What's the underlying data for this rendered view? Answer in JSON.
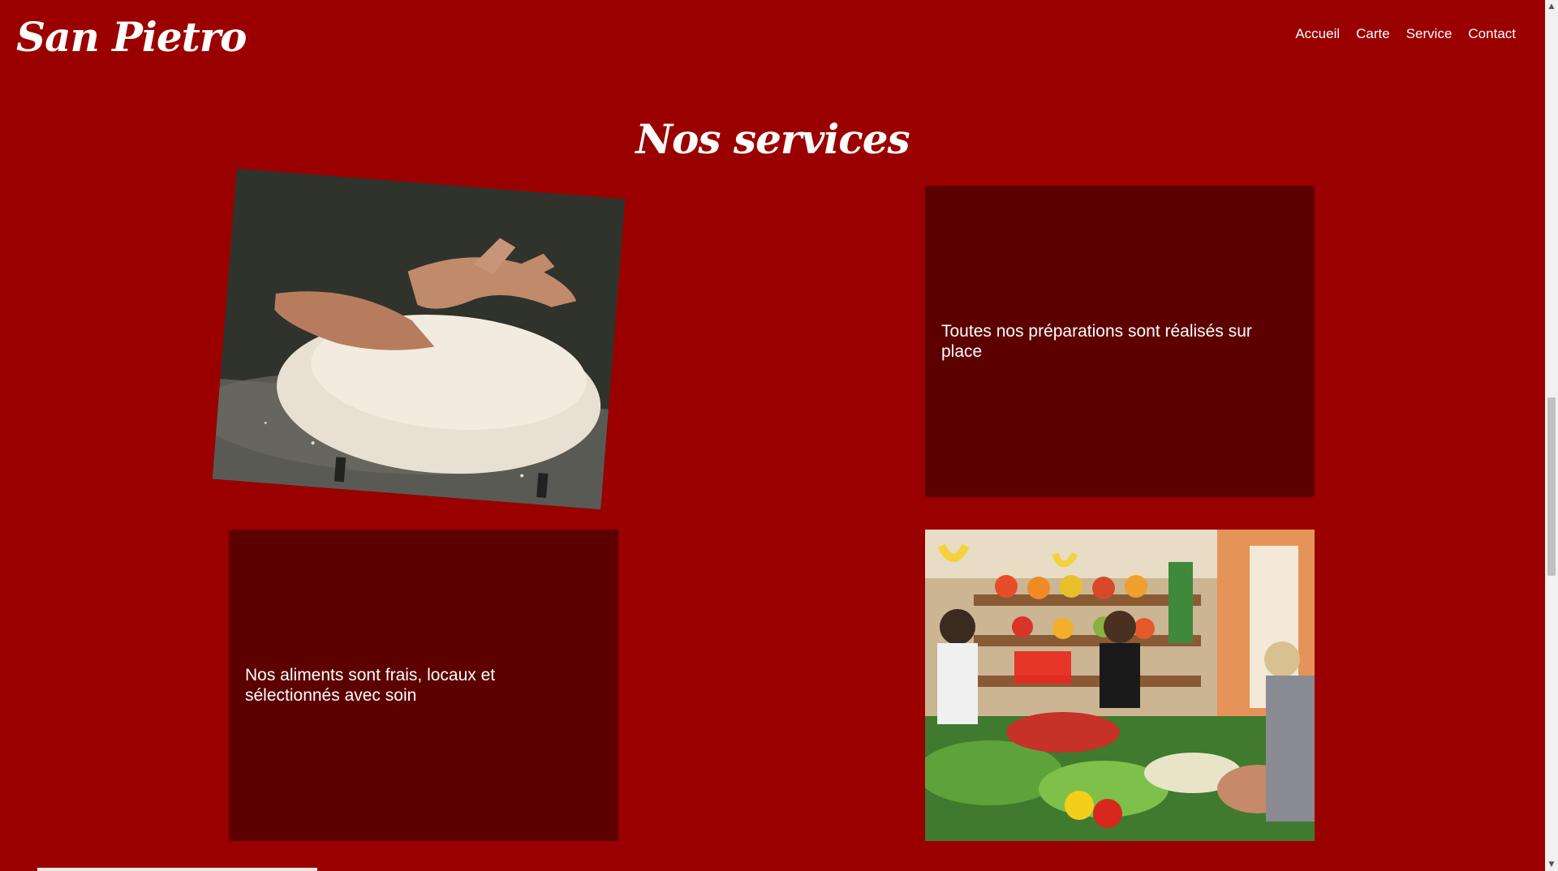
{
  "header": {
    "logo": "San Pietro",
    "nav": [
      "Accueil",
      "Carte",
      "Service",
      "Contact"
    ]
  },
  "services": {
    "title": "Nos services",
    "card_prep_text": "Toutes nos préparations sont réalisés sur place",
    "card_food_text": "Nos aliments sont frais, locaux et sélectionnés avec soin"
  },
  "colors": {
    "background": "#9b0000",
    "card": "#5c0000",
    "text": "#ffffff"
  }
}
